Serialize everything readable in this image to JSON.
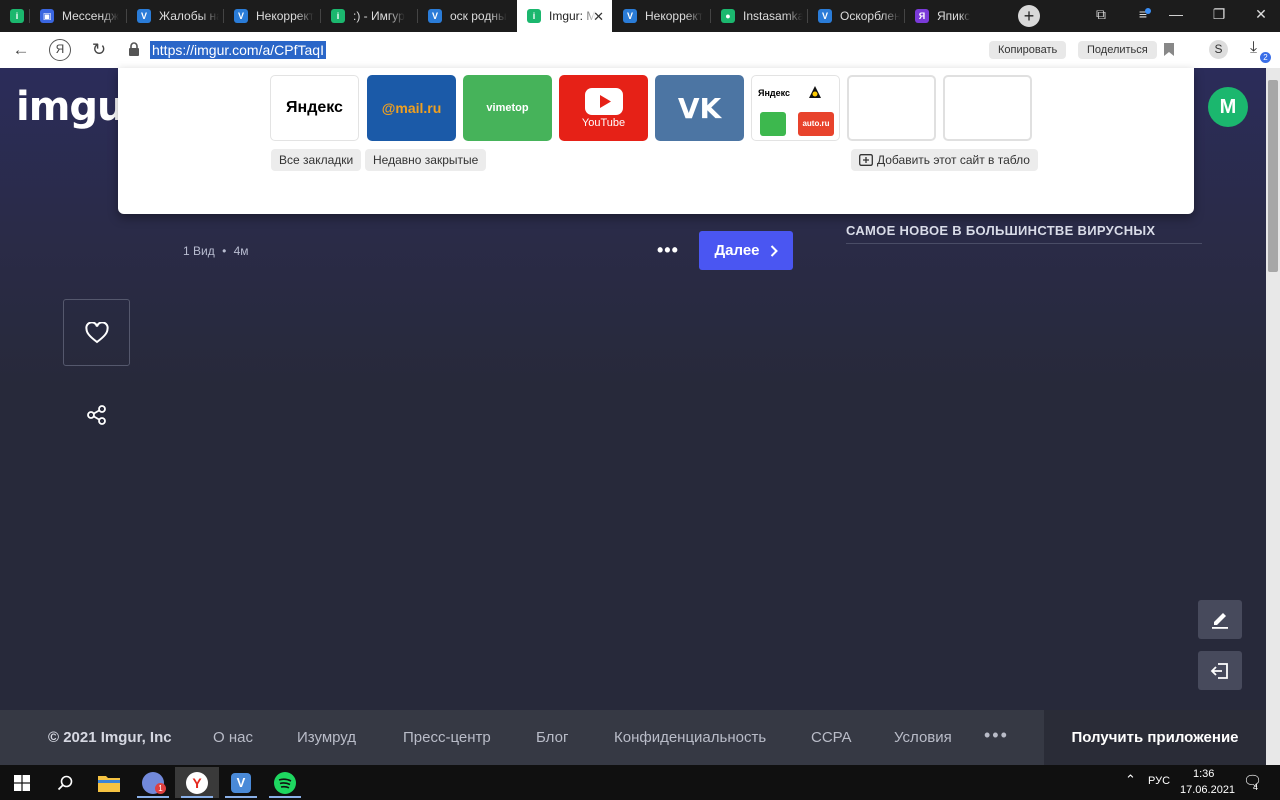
{
  "tabs": [
    {
      "title": "Мессендж",
      "color": "#3a66e0",
      "letter": "▣"
    },
    {
      "title": "Жалобы на",
      "color": "#2a7cd8",
      "letter": "V"
    },
    {
      "title": "Некоррект",
      "color": "#2a7cd8",
      "letter": "V"
    },
    {
      "title": ":) - Имгур",
      "color": "#1bb76e",
      "letter": "i"
    },
    {
      "title": "оск родны",
      "color": "#2a7cd8",
      "letter": "V"
    },
    {
      "title": "Imgur: M",
      "color": "#1bb76e",
      "letter": "i"
    },
    {
      "title": "Некоррект",
      "color": "#2a7cd8",
      "letter": "V"
    },
    {
      "title": "Instasamka",
      "color": "#1bb76e",
      "letter": "●"
    },
    {
      "title": "Оскорблен",
      "color": "#2a7cd8",
      "letter": "V"
    },
    {
      "title": "Япикс",
      "color": "#7a3ad8",
      "letter": "Я"
    }
  ],
  "address": {
    "url": "https://imgur.com/a/CPfTaqI",
    "copy_label": "Копировать",
    "share_label": "Поделиться"
  },
  "panel": {
    "tiles": {
      "yandex": "Яндекс",
      "mail": "@mail.ru",
      "vimetop": "vimetop",
      "youtube": "YouTube",
      "vk": "VK",
      "combo_yandex": "Яндекс",
      "combo_auto": "auto.ru"
    },
    "all_bookmarks": "Все закладки",
    "recently_closed": "Недавно закрытые",
    "add_site": "Добавить этот сайт в табло"
  },
  "page": {
    "logo": "imgur",
    "avatar_letter": "M",
    "meta_views": "1 Вид",
    "meta_sep": "•",
    "meta_time": "4м",
    "next_label": "Далее",
    "side_heading": "САМОЕ НОВОЕ В БОЛЬШИНСТВЕ ВИРУСНЫХ"
  },
  "footer": {
    "copyright": "© 2021 Imgur, Inc",
    "links": [
      "О нас",
      "Изумруд",
      "Пресс-центр",
      "Блог",
      "Конфиденциальность",
      "CCPA",
      "Условия"
    ],
    "more": "•••",
    "get_app": "Получить приложение"
  },
  "taskbar": {
    "lang": "РУС",
    "time": "1:36",
    "date": "17.06.2021",
    "notif_count": "4",
    "discord_badge": "1"
  },
  "download_badge": "2"
}
